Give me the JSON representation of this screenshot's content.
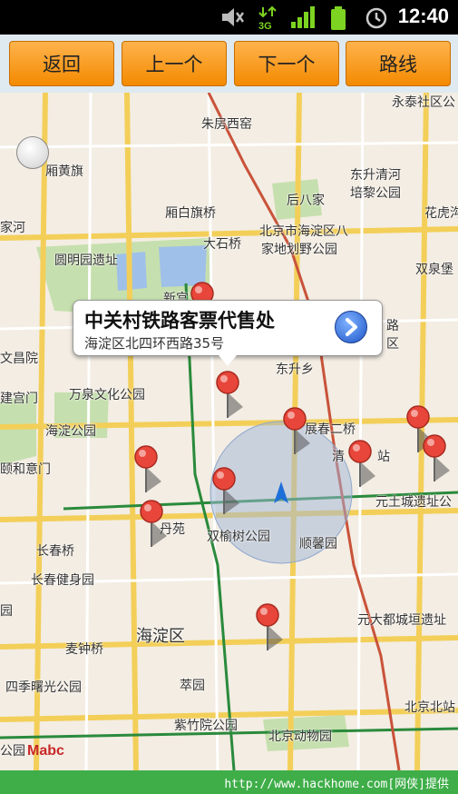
{
  "status_bar": {
    "time": "12:40",
    "network": "3G"
  },
  "toolbar": {
    "back": "返回",
    "prev": "上一个",
    "next": "下一个",
    "route": "路线"
  },
  "popup": {
    "title": "中关村铁路客票代售处",
    "address": "海淀区北四环西路35号"
  },
  "map_labels": {
    "l1": "永泰社区公",
    "l2": "朱房西窑",
    "l3": "厢黄旗",
    "l4": "东升清河",
    "l5": "培黎公园",
    "l6": "后八家",
    "l7": "花虎沟",
    "l8": "厢白旗桥",
    "l9": "北京市海淀区八",
    "l10": "家地划野公园",
    "l11": "家河",
    "l12": "大石桥",
    "l13": "圆明园遗址",
    "l14": "双泉堡",
    "l15": "新宫",
    "l16": "路",
    "l17": "区",
    "l18": "文昌院",
    "l19": "东升乡",
    "l20": "建宫门",
    "l21": "万泉文化公园",
    "l22": "海淀公园",
    "l23": "展春二桥",
    "l24": "清",
    "l25": "站",
    "l26": "颐和意门",
    "l27": "元土城遗址公",
    "l28": "丹苑",
    "l29": "双榆树公园",
    "l30": "长春桥",
    "l31": "顺馨园",
    "l32": "长春健身园",
    "l33": "海淀区",
    "l34": "元大都城垣遗址",
    "l35": "麦钟桥",
    "l36": "四季曙光公园",
    "l37": "萃园",
    "l38": "北京北站",
    "l39": "紫竹院公园",
    "l40": "北京动物园",
    "l41": "公园",
    "l42": "园"
  },
  "map_logo": "Mabc",
  "footer": {
    "text": "http://www.hackhome.com[网侠]提供"
  },
  "colors": {
    "toolbar_button": "#f6941f",
    "footer": "#3fae49",
    "pin": "#e8463a"
  }
}
